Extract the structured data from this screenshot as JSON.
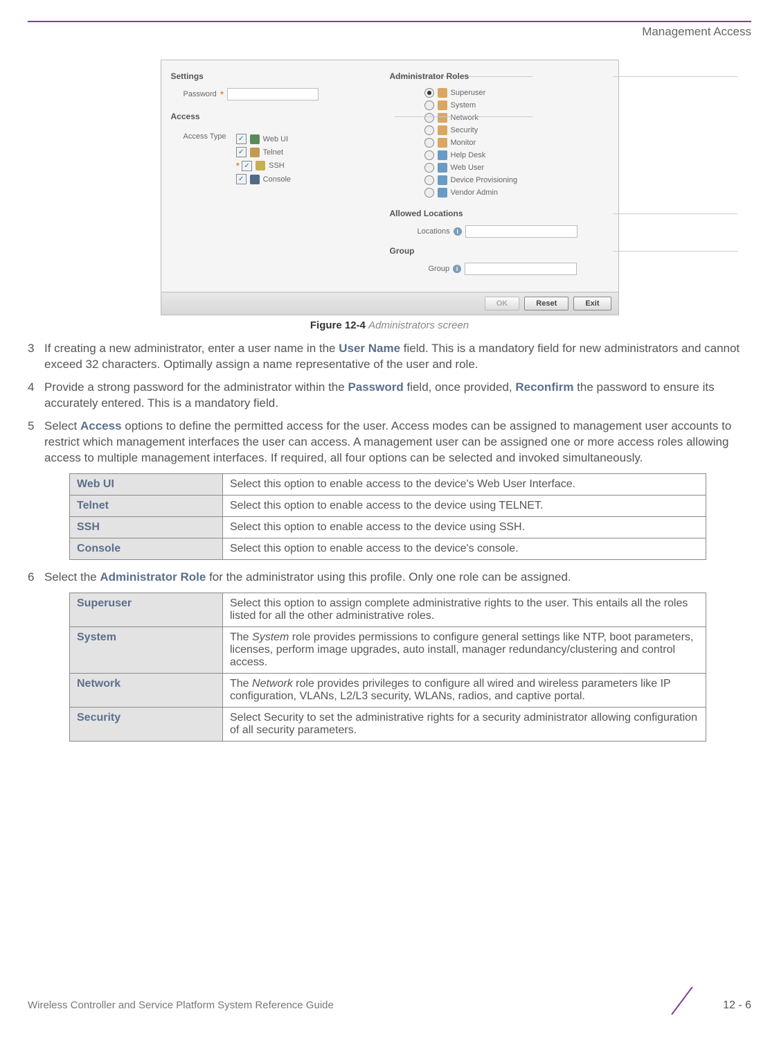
{
  "header": {
    "section": "Management Access"
  },
  "screenshot": {
    "settings_label": "Settings",
    "password_label": "Password",
    "access_label": "Access",
    "access_type_label": "Access Type",
    "access_types": [
      "Web UI",
      "Telnet",
      "SSH",
      "Console"
    ],
    "admin_roles_label": "Administrator Roles",
    "roles": [
      "Superuser",
      "System",
      "Network",
      "Security",
      "Monitor",
      "Help Desk",
      "Web User",
      "Device Provisioning",
      "Vendor Admin"
    ],
    "allowed_locations_label": "Allowed Locations",
    "locations_label": "Locations",
    "group_section_label": "Group",
    "group_label": "Group",
    "buttons": {
      "ok": "OK",
      "reset": "Reset",
      "exit": "Exit"
    }
  },
  "figure": {
    "num": "Figure 12-4",
    "title": "Administrators screen"
  },
  "steps": {
    "s3": {
      "num": "3",
      "pre": "If creating a new administrator, enter a user name in the ",
      "hl": "User Name",
      "post": " field. This is a mandatory field for new administrators and cannot exceed 32 characters. Optimally assign a name representative of the user and role."
    },
    "s4": {
      "num": "4",
      "pre": "Provide a strong password for the administrator within the ",
      "hl1": "Password",
      "mid": " field, once provided, ",
      "hl2": "Reconfirm",
      "post": " the password to ensure its accurately entered. This is a mandatory field."
    },
    "s5": {
      "num": "5",
      "pre": "Select ",
      "hl": "Access",
      "post": " options to define the permitted access for the user. Access modes can be assigned to management user accounts to restrict which management interfaces the user can access. A management user can be assigned one or more access roles allowing access to multiple management interfaces. If required, all four options can be selected and invoked simultaneously."
    },
    "s6": {
      "num": "6",
      "pre": "Select the ",
      "hl": "Administrator Role",
      "post": " for the administrator using this profile. Only one role can be assigned."
    }
  },
  "table_access": {
    "r0": {
      "k": "Web UI",
      "v": "Select this option to enable access to the device's Web User Interface."
    },
    "r1": {
      "k": "Telnet",
      "v": "Select this option to enable access to the device using TELNET."
    },
    "r2": {
      "k": "SSH",
      "v": "Select this option to enable access to the device using SSH."
    },
    "r3": {
      "k": "Console",
      "v": "Select this option to enable access to the device's console."
    }
  },
  "table_roles": {
    "r0": {
      "k": "Superuser",
      "v": "Select this option to assign complete administrative rights to the user. This entails all the roles listed for all the other administrative roles."
    },
    "r1": {
      "k": "System",
      "it": "System",
      "v_pre": "The ",
      "v_post": " role provides permissions to configure general settings like NTP, boot parameters, licenses, perform image upgrades, auto install, manager redundancy/clustering and control access."
    },
    "r2": {
      "k": "Network",
      "it": "Network",
      "v_pre": "The ",
      "v_post": " role provides privileges to configure all wired and wireless parameters like IP configuration, VLANs, L2/L3 security, WLANs, radios, and captive portal."
    },
    "r3": {
      "k": "Security",
      "v": "Select Security to set the administrative rights for a security administrator allowing configuration of all security parameters."
    }
  },
  "footer": {
    "left": "Wireless Controller and Service Platform System Reference Guide",
    "right": "12 - 6"
  }
}
